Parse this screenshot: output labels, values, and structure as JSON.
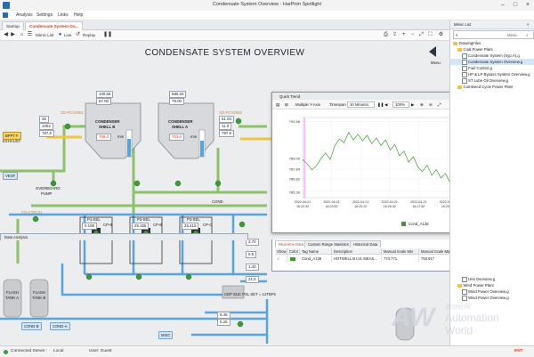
{
  "window": {
    "title": "Condensate System Overview - HarPrim Spotlight"
  },
  "menu": [
    "Analysis",
    "Settings",
    "Links",
    "Help"
  ],
  "tabs": [
    {
      "label": "Startup"
    },
    {
      "label": "Condensate System Ov..."
    }
  ],
  "toolbar": {
    "mimic_list": "Mimic List",
    "live": "Live",
    "replay": "Replay"
  },
  "canvas": {
    "title": "CONDENSATE SYSTEM OVERVIEW",
    "menu_label": "Menu",
    "shell_b": {
      "name_l1": "CONDENSER",
      "name_l2": "SHELL B",
      "level": "765.3",
      "unit": "mm"
    },
    "shell_a": {
      "name_l1": "CONDENSER",
      "name_l2": "SHELL A",
      "level": "763.0",
      "unit": "mm"
    },
    "values": {
      "v100": "100.65",
      "v97": "97.00",
      "v51": "51.04",
      "v11": "11.0",
      "v580": "580.34",
      "v79": "79.00",
      "v8": "8.00",
      "v05": "0.5",
      "v35": "35",
      "v1002": "1002",
      "v787": "787.6",
      "vk": "100.0",
      "v8b": "8.5",
      "v787b": "787.8"
    },
    "tags": {
      "bppt": "BPPT F",
      "bppt2": "EXHAUST",
      "vent": "VENT",
      "cd1": "CD-FCV2001",
      "cd2": "CD-FCV2002",
      "overboard": "OVERBOARD",
      "pump": "PUMP",
      "ctrl": "CD-CTRL01",
      "cond": "COND",
      "condb": "COND-B",
      "condc": "COND-A",
      "misc": "MISC",
      "flash1": "FLASH",
      "flash1b": "TANK A",
      "flash2": "FLASH",
      "flash2b": "TANK B",
      "setpoint": "CEP SUC PSL SET = 12TBPs"
    },
    "pumps": [
      {
        "name": "P1-SEL",
        "sub": "CP-B",
        "v1": "0.109",
        "v2": "0.0"
      },
      {
        "name": "P2-SEL",
        "sub": "CP-B",
        "v1": "25.155",
        "v2": "0.0"
      },
      {
        "name": "P3-SEL",
        "sub": "CP-C",
        "v1": "25.415",
        "v2": "0.0"
      }
    ],
    "right_vals": {
      "r1": "3.70",
      "r2": "6.5",
      "r3": "1.40",
      "r4": "21.5",
      "r5": "6.45",
      "r6": "0.26",
      "unit": "kPa"
    }
  },
  "trend": {
    "title": "Quick Trend",
    "multiple_axis": "Multiple Y-Axis",
    "timespan_label": "Timespan",
    "timespan": "10 Minutes",
    "zoom": "100%",
    "y_ticks": [
      "792.98",
      "789.00",
      "787.84",
      "786.82",
      "785.39"
    ],
    "x_ticks": [
      "2022-04-21\n16:22:32",
      "2022-04-21\n16:23:52",
      "2022-04-21\n16:25:12",
      "2022-04-21\n16:26:32",
      "2022-04-21\n16:27:52",
      "2022-04-21\n16:29:12",
      "2022-04-21\n16:30:32",
      "2022-04-21\n16:32:32"
    ],
    "legend": "Cond_A136",
    "series_values": [
      788.9,
      788.4,
      787.8,
      788.2,
      789.0,
      789.6,
      788.9,
      790.4,
      791.1,
      790.7,
      791.8,
      791.0,
      791.6,
      790.9,
      791.5,
      790.6,
      791.2,
      790.4,
      791.0,
      789.9,
      790.5,
      789.3,
      789.8,
      788.6,
      789.2,
      788.1,
      787.6,
      788.3,
      787.2,
      787.8,
      786.9,
      787.4,
      786.4,
      787.0,
      786.0,
      786.6,
      785.8,
      786.9,
      787.3,
      788.6,
      787.9,
      788.4,
      789.3,
      788.7,
      788.1
    ]
  },
  "data_analysis": {
    "title": "Data Analysis",
    "tabs": [
      "Real-time Data",
      "Custom Range Statistics",
      "Historical Data"
    ],
    "columns": [
      "Show",
      "Color",
      "Tag Name",
      "Description",
      "Manual Scale Min",
      "Manual Scale Max",
      "Real-time V...",
      "Unit"
    ],
    "row": {
      "show": "✓",
      "tag": "Cond_A136",
      "desc": "HOTWELL B LVL MEAS...",
      "min": "774.771",
      "max": "793.917",
      "rt": "785.826",
      "unit": ""
    }
  },
  "mimic_panel": {
    "title": "Mimic List",
    "search_placeholder": "Mimic",
    "items": [
      {
        "label": "DrawingFiles",
        "kind": "folder",
        "indent": 0
      },
      {
        "label": "Coal Power Plant",
        "kind": "folder",
        "indent": 1
      },
      {
        "label": "Condensate System (Syp.A).g",
        "kind": "doc",
        "indent": 2
      },
      {
        "label": "Condensate System Overview.g",
        "kind": "doc",
        "indent": 2,
        "selected": true
      },
      {
        "label": "Fuel Control.g",
        "kind": "doc",
        "indent": 2
      },
      {
        "label": "HP & LP Bypass System Overview.g",
        "kind": "doc",
        "indent": 2
      },
      {
        "label": "ST Lube Oil Overview.g",
        "kind": "doc",
        "indent": 2
      },
      {
        "label": "Combined Cycle Power Plant",
        "kind": "folder",
        "indent": 1
      }
    ],
    "bottom_items": [
      {
        "label": "Unit Overview.g",
        "kind": "doc",
        "indent": 2
      },
      {
        "label": "Wind Power Plant",
        "kind": "folder",
        "indent": 1
      },
      {
        "label": "Wind Power Overview.g",
        "kind": "doc",
        "indent": 2
      },
      {
        "label": "Wind Power Overview.g",
        "kind": "doc",
        "indent": 2
      }
    ]
  },
  "status": {
    "connected": "Connected Server :",
    "server": "Local",
    "user": "User: Guest",
    "brand": "ENT"
  },
  "watermark": {
    "cn": "自动化网",
    "l1": "Automation",
    "l2": "World"
  },
  "colors": {
    "accent": "#c8462a",
    "trend_line": "#3f9a2e",
    "cursor": "#ff00ff",
    "pipe_green": "#8fc06b",
    "pipe_blue": "#5aa4de",
    "pipe_yellow": "#f0c640"
  }
}
